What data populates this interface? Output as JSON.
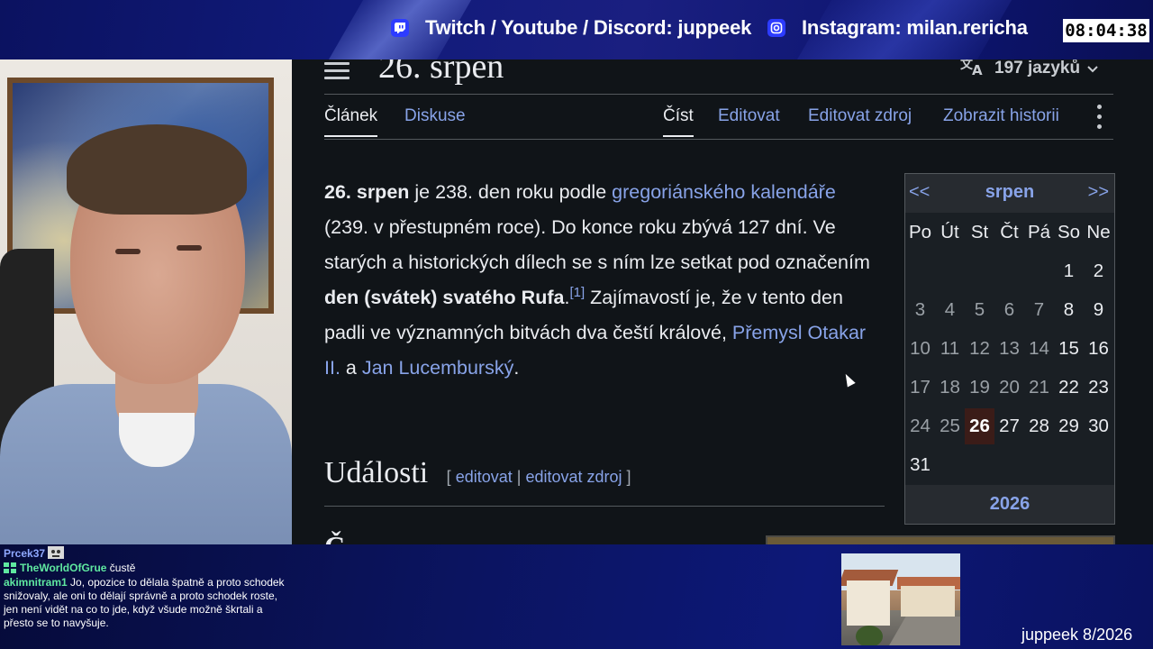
{
  "banner": {
    "socials_label": "Twitch / Youtube / Discord: juppeek",
    "instagram_label": "Instagram: milan.rericha",
    "clock": "08:04:38"
  },
  "wiki": {
    "page_title": "26. srpen",
    "languages": "197 jazyků",
    "tabs_left": [
      "Článek",
      "Diskuse"
    ],
    "tabs_right": [
      "Číst",
      "Editovat",
      "Editovat zdroj",
      "Zobrazit historii"
    ],
    "article": {
      "bold_subject": "26. srpen",
      "t1": " je 238. den roku podle ",
      "link_gregorian": "gregoriánského kalendáře",
      "t2": " (239. v přestupném roce). Do konce roku zbývá 127 dní. Ve starých a historických dílech se s ním lze setkat pod označením ",
      "bold_feast": "den (svátek) svatého Rufa",
      "t3": ".",
      "ref": "[1]",
      "t4": " Zajímavostí je, že v tento den padli ve významných bitvách dva čeští králové, ",
      "link_premysl": "Přemysl Otakar II.",
      "t5": " a ",
      "link_jan": "Jan Lucemburský",
      "t6": "."
    },
    "section": {
      "title": "Události",
      "bracket_open": "[",
      "edit": "editovat",
      "sep": "|",
      "edit_source": "editovat zdroj",
      "bracket_close": "]"
    },
    "next_heading": "Č…"
  },
  "calendar": {
    "prev": "<<",
    "month": "srpen",
    "next": ">>",
    "weekdays": [
      "Po",
      "Út",
      "St",
      "Čt",
      "Pá",
      "So",
      "Ne"
    ],
    "rows": [
      [
        "",
        "",
        "",
        "",
        "",
        "1",
        "2"
      ],
      [
        "3",
        "4",
        "5",
        "6",
        "7",
        "8",
        "9"
      ],
      [
        "10",
        "11",
        "12",
        "13",
        "14",
        "15",
        "16"
      ],
      [
        "17",
        "18",
        "19",
        "20",
        "21",
        "22",
        "23"
      ],
      [
        "24",
        "25",
        "26",
        "27",
        "28",
        "29",
        "30"
      ],
      [
        "31",
        "",
        "",
        "",
        "",
        "",
        ""
      ]
    ],
    "today": "26",
    "year": "2026"
  },
  "chat": [
    {
      "user": "Prcek37",
      "user_color": "#8fa8ff",
      "text": ""
    },
    {
      "user": "TheWorldOfGrue",
      "user_color": "#5fe8a0",
      "text": "čustě"
    },
    {
      "user": "akimnitram1",
      "user_color": "#5fe8a0",
      "text": "Jo, opozice to dělala špatně a proto schodek snižovaly, ale oni to dělají správně a proto schodek roste, jen není vidět na co to jde, když všude možně škrtali a přesto se to navyšuje."
    }
  ],
  "footer": {
    "label": "juppeek 8/2026"
  },
  "colors": {
    "link": "#88a3e8",
    "text": "#eaecf0",
    "background": "#101418",
    "banner": "#101a7a"
  }
}
